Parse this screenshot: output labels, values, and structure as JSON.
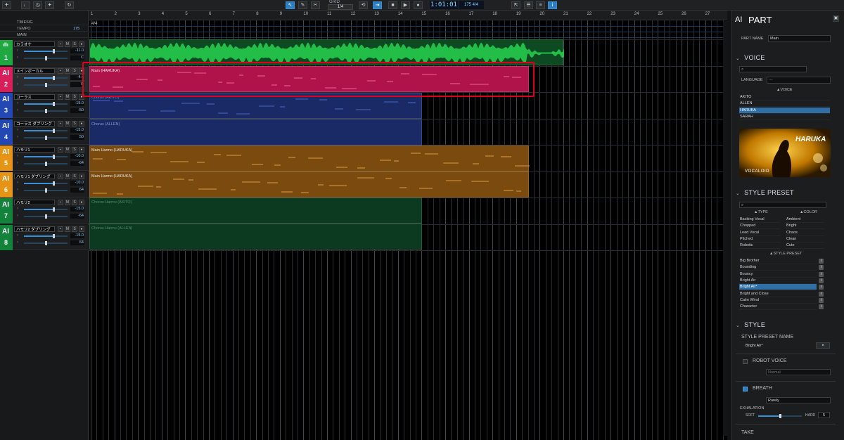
{
  "toolbar": {
    "add_icon": "+",
    "grid_label": "GRID",
    "grid_value": "1/4",
    "time": "1:01:01",
    "tempo": "175",
    "timesig": "4/4",
    "info_icon": "i"
  },
  "header_rows": {
    "timesig": "TIMESIG",
    "tempo": "TEMPO",
    "tempo_value": "175",
    "main": "MAIN"
  },
  "tracks": [
    {
      "num": "1",
      "ai": "",
      "name": "カラオケ",
      "vol": "-11.0",
      "pan": "C",
      "color": "#1fa742"
    },
    {
      "num": "2",
      "ai": "AI",
      "name": "メインボーカル",
      "vol": "-4.4",
      "pan": "C",
      "color": "#d81e5b"
    },
    {
      "num": "3",
      "ai": "AI",
      "name": "コーラス",
      "vol": "-15.0",
      "pan": "-50",
      "color": "#2347b3"
    },
    {
      "num": "4",
      "ai": "AI",
      "name": "コーラス ダブリング",
      "vol": "-15.0",
      "pan": "50",
      "color": "#2347b3"
    },
    {
      "num": "5",
      "ai": "AI",
      "name": "ハモリ1",
      "vol": "-10.0",
      "pan": "-64",
      "color": "#e59416"
    },
    {
      "num": "6",
      "ai": "AI",
      "name": "ハモリ1 ダブリング",
      "vol": "-10.0",
      "pan": "64",
      "color": "#e59416"
    },
    {
      "num": "7",
      "ai": "AI",
      "name": "ハモリ2",
      "vol": "-15.0",
      "pan": "-64",
      "color": "#13833c"
    },
    {
      "num": "8",
      "ai": "AI",
      "name": "ハモリ2 ダブリング",
      "vol": "-15.0",
      "pan": "64",
      "color": "#13833c"
    }
  ],
  "ruler": {
    "timesig": "4/4",
    "bars": [
      "1",
      "2",
      "3",
      "4",
      "5",
      "6",
      "7",
      "8",
      "9",
      "10",
      "11",
      "12",
      "13",
      "14",
      "15",
      "16",
      "17",
      "18",
      "19",
      "20",
      "21",
      "22",
      "23",
      "24",
      "25",
      "26",
      "27"
    ]
  },
  "parts": {
    "main": "Main (HARUKA)",
    "chorus1": "Chorus (AKITO)",
    "chorus2": "Chorus (ALLEN)",
    "harmo1": "Main Harmo (HARUKA)",
    "harmo2": "Main Harmo (HARUKA)",
    "chorus_harmo1": "Chorus Harmo (AKITO)",
    "chorus_harmo2": "Chorus Harmo (ALLEN)"
  },
  "panel": {
    "ai_badge": "AI",
    "title": "PART",
    "part_name_label": "PART NAME",
    "part_name_value": "Main",
    "voice": {
      "title": "VOICE",
      "search_icon": "⌕",
      "language_label": "LANGUAGE",
      "language_value": "---",
      "voice_header": "▲VOICE",
      "voices": [
        "AKITO",
        "ALLEN",
        "HARUKA",
        "SARAH"
      ],
      "selected": "HARUKA",
      "image_name": "HARUKA",
      "image_brand": "VOCALOID"
    },
    "style_preset": {
      "title": "STYLE PRESET",
      "search_icon": "⌕",
      "type_header": "▲TYPE",
      "color_header": "▲COLOR",
      "types": [
        "Backing Vocal",
        "Chopped",
        "Lead Vocal",
        "Pitched",
        "Robotic"
      ],
      "colors": [
        "Ambient",
        "Bright",
        "Chaos",
        "Clean",
        "Cute"
      ],
      "preset_header": "▲STYLE PRESET",
      "presets": [
        "Big Brother",
        "Bounding",
        "Bouncy",
        "Bright Air",
        "Bright Air*",
        "Bright and Close",
        "Calm Wind",
        "Character"
      ],
      "selected": "Bright Air*"
    },
    "style": {
      "title": "STYLE",
      "preset_name_label": "STYLE PRESET NAME",
      "preset_name_value": "Bright Air*",
      "robot_label": "ROBOT VOICE",
      "robot_value": "Normal",
      "breath_label": "BREATH",
      "breath_value": "Rarely",
      "exhalation_label": "EXHALATION",
      "soft_label": "SOFT",
      "hard_label": "HARD",
      "exhalation_value": "5",
      "exhalation_level": 0.5
    },
    "take_label": "TAKE"
  }
}
